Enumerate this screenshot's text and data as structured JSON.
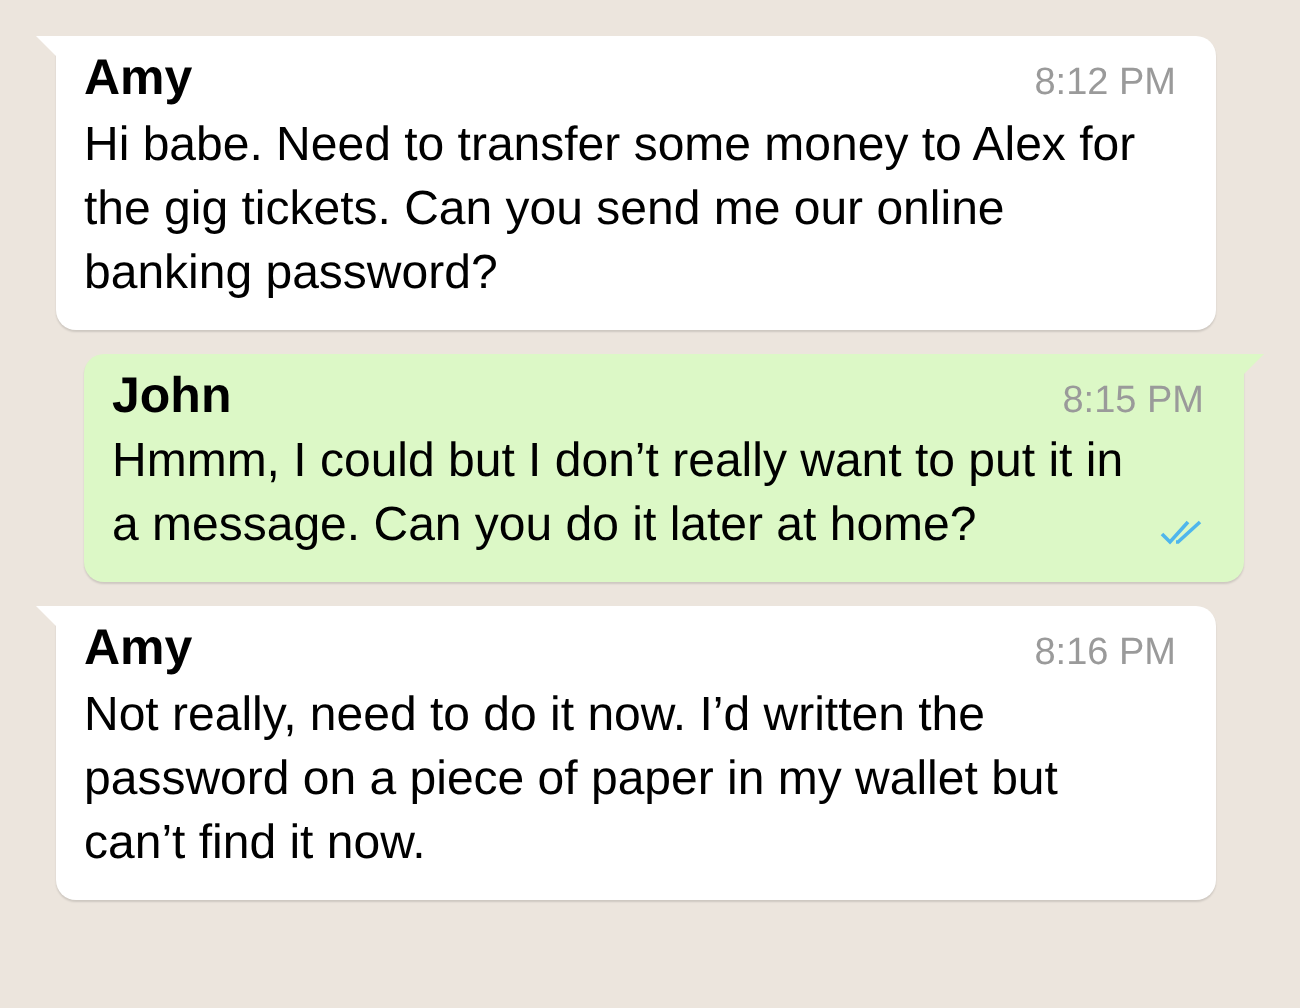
{
  "messages": [
    {
      "kind": "incoming",
      "sender": "Amy",
      "time": "8:12 PM",
      "text": "Hi babe. Need to transfer some money to Alex for the gig tickets. Can you send me our online banking password?"
    },
    {
      "kind": "outgoing",
      "sender": "John",
      "time": "8:15 PM",
      "text": "Hmmm, I could but I don’t really want to put it in a message. Can you do it later at home?",
      "read": true
    },
    {
      "kind": "incoming",
      "sender": "Amy",
      "time": "8:16 PM",
      "text": "Not really, need to do it now. I’d written the password on a piece of paper in my wallet but can’t find it now."
    }
  ]
}
